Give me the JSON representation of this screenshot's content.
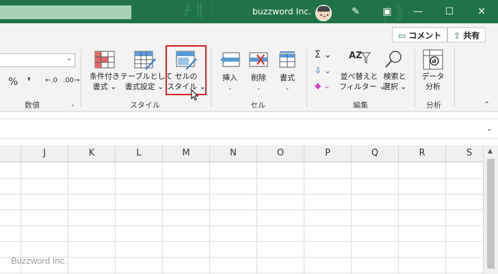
{
  "titlebar": {
    "account_name": "buzzword Inc.",
    "avatar_face": "•ᴗ•",
    "pen_icon": "✎",
    "ribbon_display_icon": "▣",
    "minimize_icon": "—",
    "maximize_icon": "☐",
    "close_icon": "✕",
    "deco_left": "ᚋ ǁ ᛁ",
    "deco_right": "ʃ 》"
  },
  "share_row": {
    "comment_icon": "▭",
    "comment_label": "コメント",
    "share_icon": "⇪",
    "share_label": "共有"
  },
  "ribbon": {
    "number_format_arrow": "⌄",
    "percent": "%",
    "comma": "❜",
    "inc_decimal": "←.0",
    "dec_decimal": ".00→",
    "number_group": "数値",
    "number_launcher": "⌟",
    "cond_format_1": "条件付き",
    "cond_format_2": "書式 ⌄",
    "table_format_1": "テーブルとして",
    "table_format_2": "書式設定 ⌄",
    "cell_styles_1": "セルの",
    "cell_styles_2": "スタイル ⌄",
    "styles_group": "スタイル",
    "insert_label": "挿入",
    "insert_chev": "⌄",
    "delete_label": "削除",
    "delete_chev": "⌄",
    "format_label": "書式",
    "format_chev": "⌄",
    "cells_group": "セル",
    "autosum_icon": "Σ ⌄",
    "fill_icon": "⇩ ⌄",
    "clear_icon": "◆ ⌄",
    "sort_icon_text": "AZ",
    "sort_label_1": "並べ替えと",
    "sort_label_2": "フィルター ⌄",
    "find_label_1": "検索と",
    "find_label_2": "選択 ⌄",
    "editing_group": "編集",
    "analyze_label_1": "データ",
    "analyze_label_2": "分析",
    "analysis_group": "分析",
    "collapse_icon": "⌃"
  },
  "formula_bar": {
    "expand_icon": "⌄"
  },
  "sheet": {
    "columns": [
      "J",
      "K",
      "L",
      "M",
      "N",
      "O",
      "P",
      "Q",
      "R",
      "S"
    ],
    "scroll_up_icon": "▲"
  },
  "watermark": "Buzzword Inc."
}
